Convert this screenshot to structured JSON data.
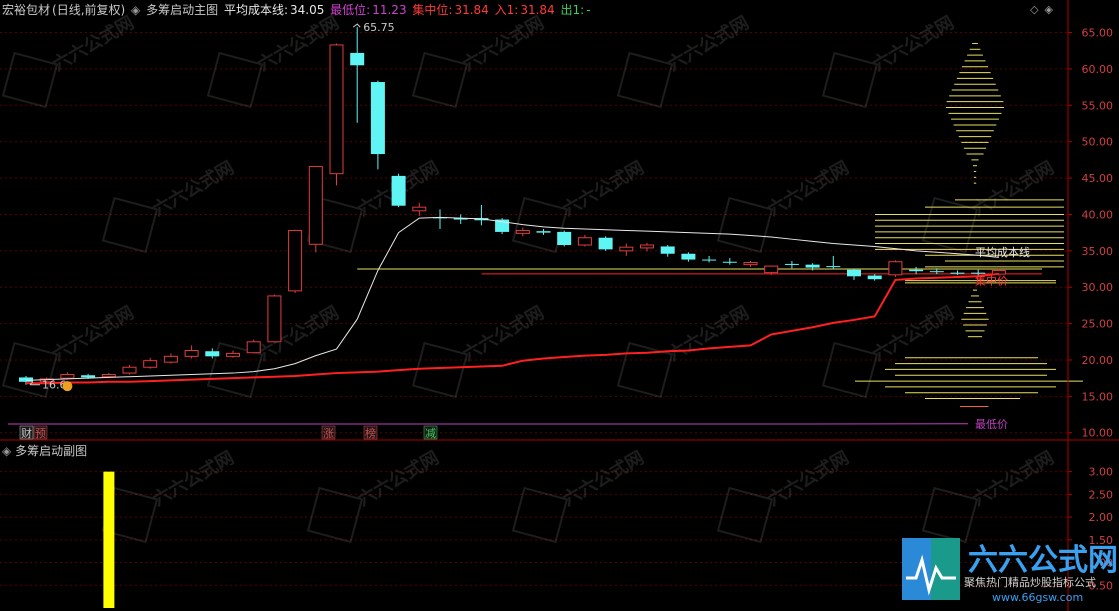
{
  "main_header": {
    "stock_name": "宏裕包材",
    "period": "(日线,前复权)",
    "indicator_name": "多筹启动主图",
    "avg_cost_label": "平均成本线:",
    "avg_cost_value": "34.05",
    "min_label": "最低位:",
    "min_value": "11.23",
    "conc_label": "集中位:",
    "conc_value": "31.84",
    "in_label": "入1:",
    "in_value": "31.84",
    "out_label": "出1:",
    "out_value": "-"
  },
  "sub_header": {
    "indicator_name": "多筹启动副图"
  },
  "annotations": {
    "high_label": "65.75",
    "low_label": "16.6",
    "avg_line_label": "平均成本线",
    "conc_line_label": "集中价",
    "min_line_label": "最低价"
  },
  "event_markers": [
    {
      "text": "财",
      "color": "#c8c8c8"
    },
    {
      "text": "预",
      "color": "#d84a4a"
    },
    {
      "text": "涨",
      "color": "#d84a4a"
    },
    {
      "text": "榜",
      "color": "#d84a4a"
    },
    {
      "text": "减",
      "color": "#3ccf5a"
    }
  ],
  "watermark": {
    "brand": "六六公式网",
    "slogan": "聚焦热门精品炒股指标公式",
    "url": "www.66gsw.com"
  },
  "colors": {
    "up": "#e03c3c",
    "down": "#5ff5f5",
    "axis": "#b00000",
    "min_line": "#c040c0",
    "avg_line": "#e8e8e8",
    "conc_line": "#ff2020",
    "chip_yellow": "#e8e060",
    "bar_yellow": "#ffff00"
  },
  "chart_data": [
    {
      "type": "candlestick",
      "y_axis": {
        "min": 9,
        "max": 67,
        "ticks": [
          10,
          15,
          20,
          25,
          30,
          35,
          40,
          45,
          50,
          55,
          60,
          65
        ],
        "tick_labels": [
          "10.00",
          "15.00",
          "20.00",
          "25.00",
          "30.00",
          "35.00",
          "40.00",
          "45.00",
          "50.00",
          "55.00",
          "60.00",
          "65.00"
        ]
      },
      "candles": [
        {
          "o": 17.6,
          "c": 17.0,
          "h": 17.8,
          "l": 16.6
        },
        {
          "o": 17.0,
          "c": 17.4,
          "h": 17.6,
          "l": 16.9
        },
        {
          "o": 17.5,
          "c": 18.0,
          "h": 18.3,
          "l": 17.3
        },
        {
          "o": 17.9,
          "c": 17.6,
          "h": 18.1,
          "l": 17.4
        },
        {
          "o": 17.7,
          "c": 18.0,
          "h": 18.2,
          "l": 17.5
        },
        {
          "o": 18.2,
          "c": 19.0,
          "h": 19.3,
          "l": 18.0
        },
        {
          "o": 19.0,
          "c": 19.9,
          "h": 20.3,
          "l": 18.8
        },
        {
          "o": 19.7,
          "c": 20.5,
          "h": 20.9,
          "l": 19.5
        },
        {
          "o": 20.5,
          "c": 21.3,
          "h": 22.0,
          "l": 20.2
        },
        {
          "o": 21.2,
          "c": 20.5,
          "h": 21.6,
          "l": 20.2
        },
        {
          "o": 20.5,
          "c": 20.9,
          "h": 21.3,
          "l": 20.3
        },
        {
          "o": 21.0,
          "c": 22.5,
          "h": 22.8,
          "l": 20.9
        },
        {
          "o": 22.5,
          "c": 28.8,
          "h": 29.0,
          "l": 22.5
        },
        {
          "o": 29.5,
          "c": 37.8,
          "h": 37.9,
          "l": 29.2
        },
        {
          "o": 35.9,
          "c": 46.6,
          "h": 46.6,
          "l": 34.8
        },
        {
          "o": 45.6,
          "c": 63.3,
          "h": 63.5,
          "l": 44.0
        },
        {
          "o": 62.2,
          "c": 60.5,
          "h": 65.75,
          "l": 52.6
        },
        {
          "o": 58.2,
          "c": 48.3,
          "h": 58.4,
          "l": 46.2
        },
        {
          "o": 45.3,
          "c": 41.2,
          "h": 45.6,
          "l": 41.0
        },
        {
          "o": 40.5,
          "c": 41.0,
          "h": 41.6,
          "l": 39.8
        },
        {
          "o": 39.6,
          "c": 39.5,
          "h": 40.7,
          "l": 38.0
        },
        {
          "o": 39.5,
          "c": 39.3,
          "h": 40.0,
          "l": 38.7
        },
        {
          "o": 39.5,
          "c": 39.2,
          "h": 41.3,
          "l": 38.5
        },
        {
          "o": 39.3,
          "c": 37.6,
          "h": 39.5,
          "l": 37.3
        },
        {
          "o": 37.4,
          "c": 37.8,
          "h": 38.2,
          "l": 37.0
        },
        {
          "o": 37.7,
          "c": 37.5,
          "h": 38.0,
          "l": 37.2
        },
        {
          "o": 37.6,
          "c": 35.8,
          "h": 37.8,
          "l": 35.6
        },
        {
          "o": 35.8,
          "c": 36.8,
          "h": 37.2,
          "l": 35.6
        },
        {
          "o": 36.8,
          "c": 35.2,
          "h": 37.0,
          "l": 35.0
        },
        {
          "o": 35.0,
          "c": 35.5,
          "h": 36.0,
          "l": 34.3
        },
        {
          "o": 35.4,
          "c": 35.8,
          "h": 36.1,
          "l": 34.9
        },
        {
          "o": 35.6,
          "c": 34.6,
          "h": 35.8,
          "l": 34.2
        },
        {
          "o": 34.6,
          "c": 33.8,
          "h": 34.8,
          "l": 33.5
        },
        {
          "o": 33.8,
          "c": 33.7,
          "h": 34.3,
          "l": 33.4
        },
        {
          "o": 33.5,
          "c": 33.4,
          "h": 34.0,
          "l": 33.1
        },
        {
          "o": 33.1,
          "c": 33.4,
          "h": 33.6,
          "l": 32.8
        },
        {
          "o": 32.0,
          "c": 32.9,
          "h": 33.0,
          "l": 31.7
        },
        {
          "o": 33.2,
          "c": 33.1,
          "h": 33.6,
          "l": 32.6
        },
        {
          "o": 33.1,
          "c": 32.7,
          "h": 33.3,
          "l": 32.3
        },
        {
          "o": 32.9,
          "c": 32.8,
          "h": 34.3,
          "l": 32.5
        },
        {
          "o": 32.4,
          "c": 31.5,
          "h": 32.5,
          "l": 31.0
        },
        {
          "o": 31.6,
          "c": 31.1,
          "h": 31.8,
          "l": 30.9
        },
        {
          "o": 31.7,
          "c": 33.5,
          "h": 33.7,
          "l": 31.4
        },
        {
          "o": 32.4,
          "c": 32.2,
          "h": 32.8,
          "l": 31.8
        },
        {
          "o": 32.2,
          "c": 32.1,
          "h": 32.6,
          "l": 31.8
        },
        {
          "o": 32.0,
          "c": 31.9,
          "h": 32.3,
          "l": 31.7
        },
        {
          "o": 32.0,
          "c": 31.9,
          "h": 32.4,
          "l": 31.6
        },
        {
          "o": 31.8,
          "c": 32.3,
          "h": 32.6,
          "l": 31.6
        }
      ],
      "avg_cost_line": [
        17.2,
        17.3,
        17.4,
        17.5,
        17.6,
        17.7,
        17.8,
        17.9,
        18.0,
        18.1,
        18.2,
        18.4,
        18.8,
        19.5,
        20.6,
        21.5,
        25.6,
        32.3,
        37.5,
        39.5,
        39.6,
        39.5,
        39.4,
        39.0,
        38.6,
        38.3,
        38.1,
        38.0,
        37.9,
        37.8,
        37.7,
        37.6,
        37.5,
        37.4,
        37.3,
        37.1,
        36.9,
        36.6,
        36.3,
        36.0,
        35.8,
        35.6,
        35.3,
        35.0,
        34.8,
        34.6,
        34.4,
        34.1
      ],
      "conc_line": [
        16.8,
        16.8,
        16.9,
        16.9,
        17.0,
        17.0,
        17.1,
        17.2,
        17.3,
        17.4,
        17.5,
        17.6,
        17.7,
        17.8,
        18.0,
        18.2,
        18.3,
        18.4,
        18.6,
        18.8,
        18.9,
        19.0,
        19.1,
        19.2,
        19.9,
        20.2,
        20.4,
        20.6,
        20.7,
        20.9,
        21.0,
        21.2,
        21.3,
        21.6,
        21.8,
        22.0,
        23.5,
        24.0,
        24.5,
        25.1,
        25.5,
        26.0,
        31.0,
        31.2,
        31.3,
        31.4,
        31.5,
        31.84
      ],
      "min_line": [
        11.2,
        11.2,
        11.2,
        11.2,
        11.2,
        11.2,
        11.23
      ],
      "levels": [
        {
          "value": 32.5,
          "from": 16,
          "to": 47,
          "color": "#e8e060"
        },
        {
          "value": 31.84,
          "from": 22,
          "to": 47,
          "color": "#ff2020"
        }
      ]
    },
    {
      "type": "bar",
      "y_axis": {
        "min": 0,
        "max": 3.3,
        "ticks": [
          0.5,
          1.0,
          1.5,
          2.0,
          2.5,
          3.0
        ],
        "tick_labels": [
          "0.50",
          "1.00",
          "1.50",
          "2.00",
          "2.50",
          "3.00"
        ]
      },
      "bars": [
        {
          "index": 2,
          "value": 3.0
        }
      ]
    }
  ]
}
